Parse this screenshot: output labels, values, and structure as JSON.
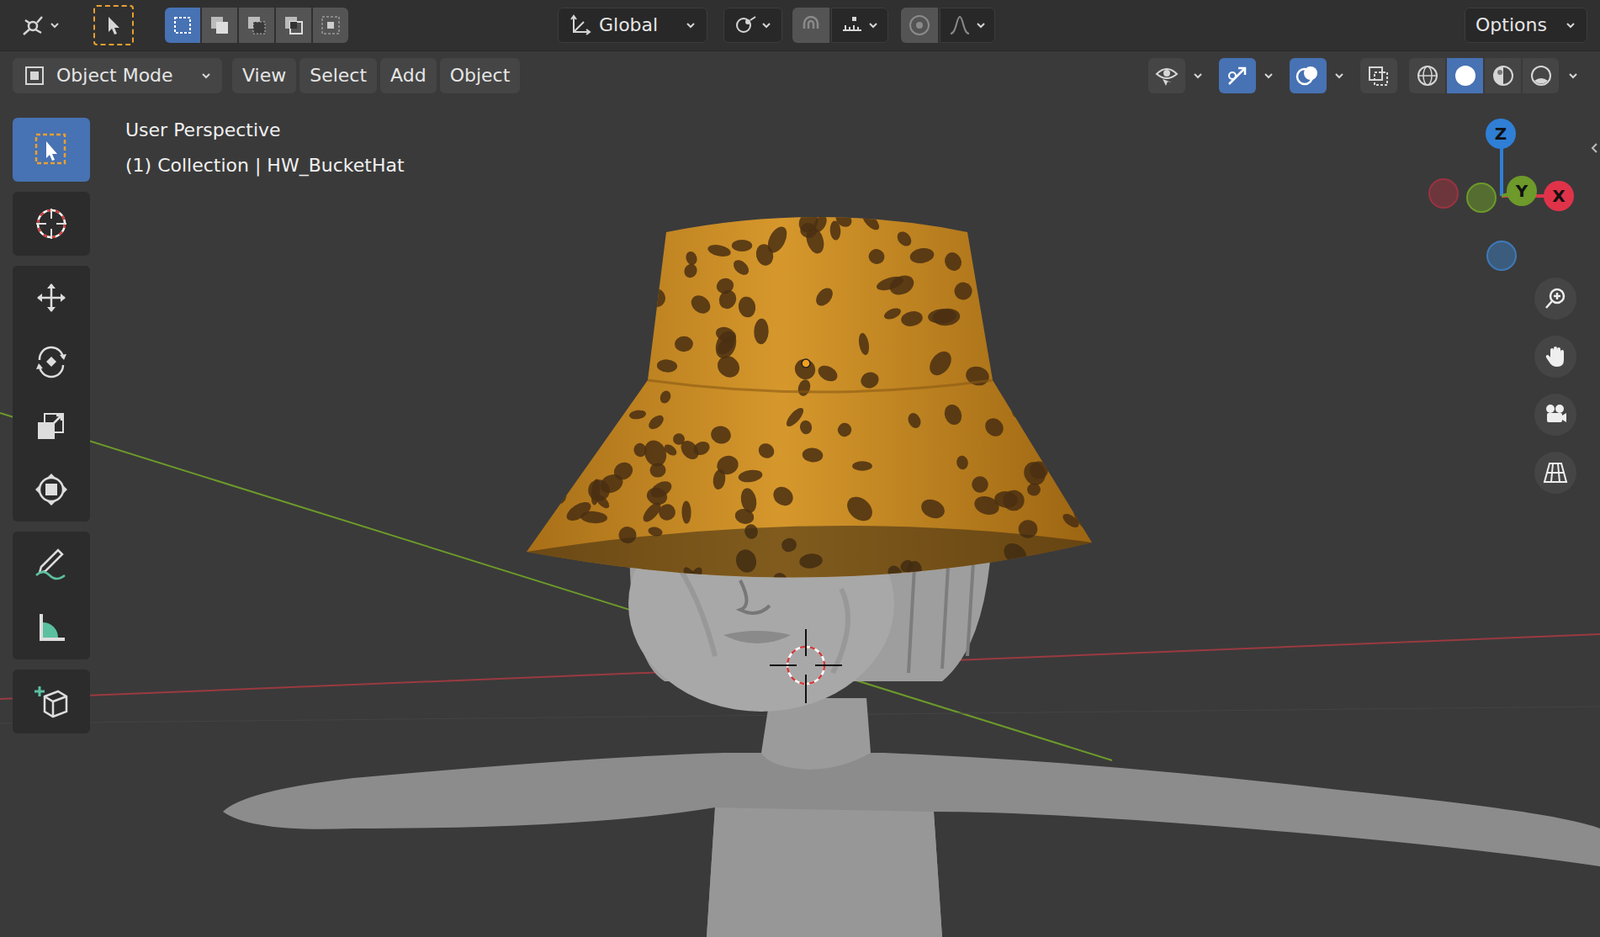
{
  "top_bar": {
    "select_modes": [
      {
        "selected": true
      },
      {
        "selected": false
      },
      {
        "selected": false
      },
      {
        "selected": false
      },
      {
        "selected": false
      }
    ],
    "orientation": "Global",
    "snap": {
      "on": false
    },
    "proportional": {
      "on": false
    },
    "options": "Options"
  },
  "header": {
    "mode": "Object Mode",
    "menus": [
      "View",
      "Select",
      "Add",
      "Object"
    ],
    "toggles": [
      {
        "kind": "visibility",
        "on": false
      },
      {
        "kind": "gizmos",
        "on": true
      },
      {
        "kind": "overlays",
        "on": true
      },
      {
        "kind": "xray",
        "on": false
      }
    ],
    "shading": [
      {
        "kind": "wireframe",
        "selected": false
      },
      {
        "kind": "solid",
        "selected": true
      },
      {
        "kind": "material",
        "selected": false
      },
      {
        "kind": "rendered",
        "selected": false
      }
    ]
  },
  "toolbar": [
    [
      {
        "kind": "select_box",
        "selected": true
      }
    ],
    [
      {
        "kind": "cursor",
        "selected": false
      }
    ],
    [
      {
        "kind": "move",
        "selected": false
      },
      {
        "kind": "rotate",
        "selected": false
      },
      {
        "kind": "scale",
        "selected": false
      },
      {
        "kind": "transform",
        "selected": false
      }
    ],
    [
      {
        "kind": "annotate",
        "selected": false
      },
      {
        "kind": "measure",
        "selected": false
      }
    ],
    [
      {
        "kind": "add_cube",
        "selected": false
      }
    ]
  ],
  "viewport": {
    "view": "User Perspective",
    "info": "(1) Collection | HW_BucketHat"
  },
  "gizmo": [
    {
      "kind": "negative",
      "color": "#9a3340"
    },
    {
      "kind": "negative",
      "color": "#3e7ab8"
    },
    {
      "kind": "negative",
      "color": "#6d9a2a"
    },
    {
      "kind": "positive",
      "label": "Z",
      "color": "#2f7fd6"
    },
    {
      "kind": "positive",
      "label": "Y",
      "color": "#6d9a2a"
    },
    {
      "kind": "positive",
      "label": "X",
      "color": "#e0334a"
    }
  ],
  "nav_buttons": [
    {
      "kind": "zoom"
    },
    {
      "kind": "pan"
    },
    {
      "kind": "camera"
    },
    {
      "kind": "ortho"
    }
  ]
}
